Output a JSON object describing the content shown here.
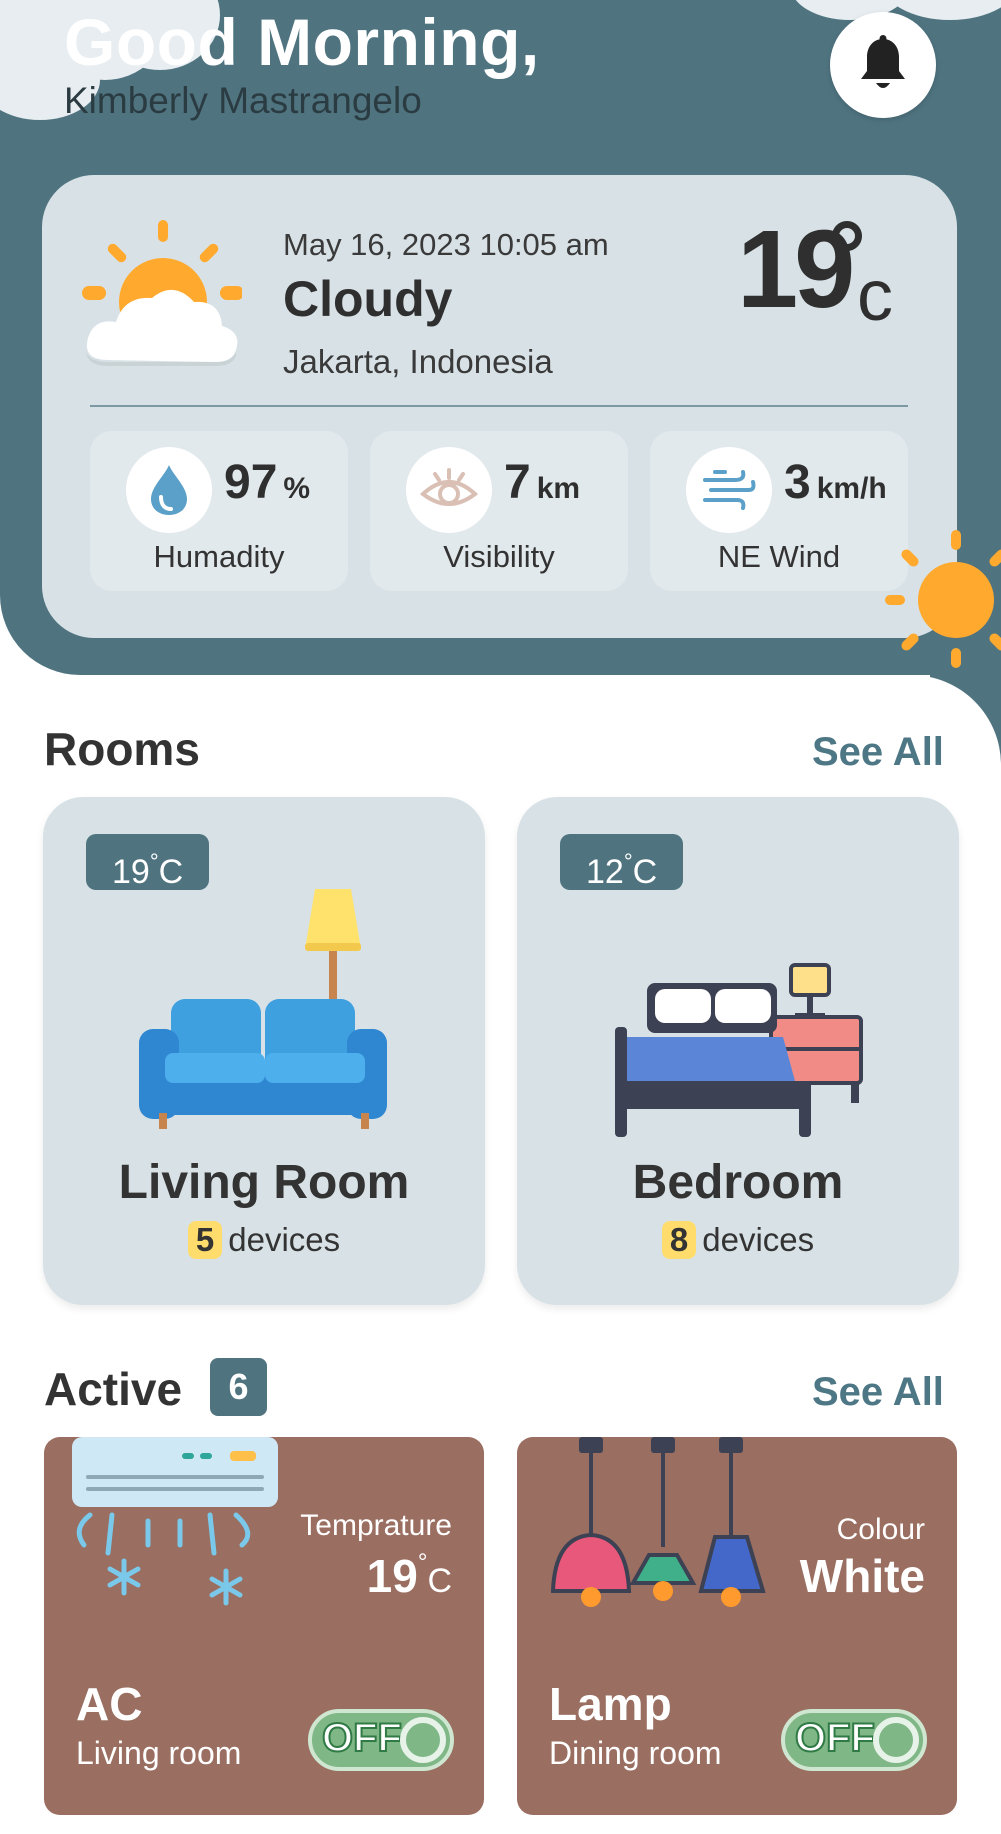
{
  "header": {
    "greeting": "Good Morning,",
    "user_name": "Kimberly Mastrangelo"
  },
  "weather": {
    "datetime": "May 16, 2023 10:05 am",
    "condition": "Cloudy",
    "location": "Jakarta, Indonesia",
    "temperature": "19",
    "unit": "c",
    "stats": [
      {
        "value": "97",
        "unit": "%",
        "label": "Humadity",
        "icon": "water-drop-icon"
      },
      {
        "value": "7",
        "unit": "km",
        "label": "Visibility",
        "icon": "eye-icon"
      },
      {
        "value": "3",
        "unit": "km/h",
        "label": "NE Wind",
        "icon": "wind-icon"
      }
    ]
  },
  "rooms": {
    "title": "Rooms",
    "see_all": "See All",
    "items": [
      {
        "temp": "19",
        "unit": "C",
        "name": "Living Room",
        "device_count": "5",
        "devices_label": "devices"
      },
      {
        "temp": "12",
        "unit": "C",
        "name": "Bedroom",
        "device_count": "8",
        "devices_label": "devices"
      }
    ]
  },
  "active": {
    "title": "Active",
    "count": "6",
    "see_all": "See All",
    "items": [
      {
        "detail_label": "Temprature",
        "detail_value": "19",
        "detail_unit": "C",
        "name": "AC",
        "room": "Living room",
        "toggle": "OFF"
      },
      {
        "detail_label": "Colour",
        "detail_value": "White",
        "name": "Lamp",
        "room": "Dining room",
        "toggle": "OFF"
      }
    ]
  },
  "colors": {
    "primary": "#4f7480",
    "card_bg": "#d8e2e6",
    "active_card": "#9a6e60",
    "sun": "#ffa92e",
    "badge_yellow": "#ffdc6b",
    "toggle_green": "#7fb787"
  }
}
